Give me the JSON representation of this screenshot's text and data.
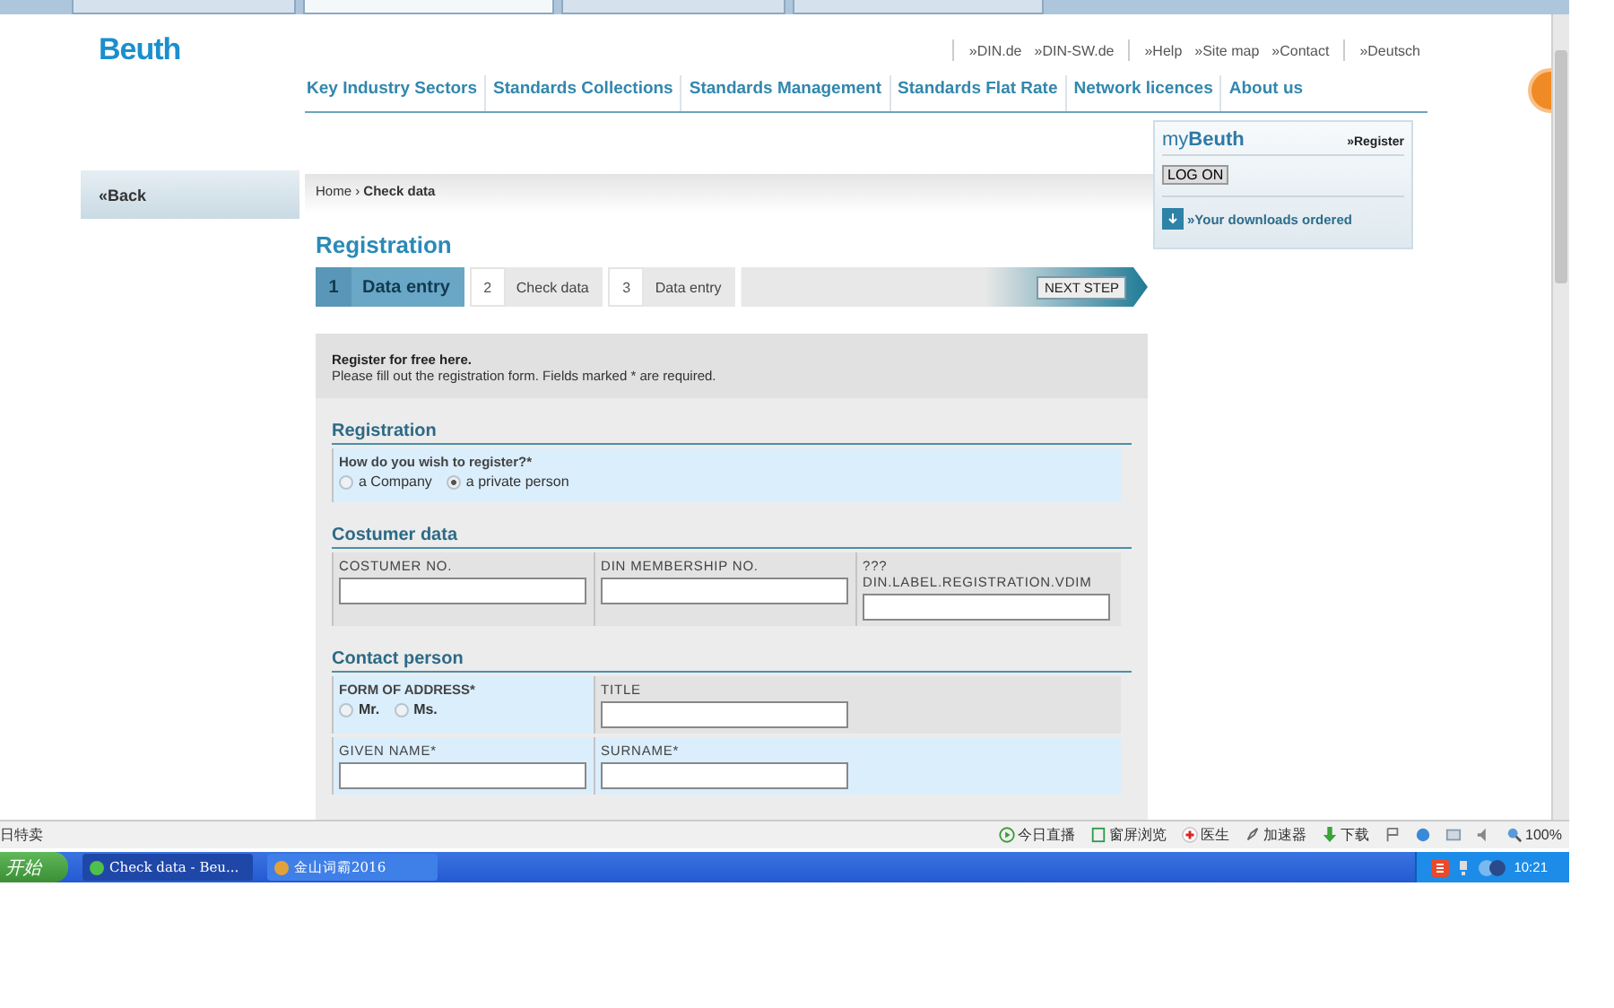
{
  "browser_tabs": [
    {
      "selected": false
    },
    {
      "selected": true
    },
    {
      "selected": false
    },
    {
      "selected": false
    }
  ],
  "site": {
    "logo": "Beuth",
    "top_links": [
      [
        "»DIN.de",
        "»DIN-SW.de"
      ],
      [
        "»Help",
        "»Site map",
        "»Contact"
      ],
      [
        "»Deutsch"
      ]
    ],
    "nav": [
      "Key Industry Sectors",
      "Standards Collections",
      "Standards Management",
      "Standards Flat Rate",
      "Network licences",
      "About us"
    ]
  },
  "back": "«Back",
  "breadcrumb": "Home › **Check data**",
  "mybeuth": {
    "prefix": "my",
    "title": "Beuth",
    "register": "»Register",
    "logon": "LOG ON",
    "downloads": "»Your downloads ordered"
  },
  "heading": "Registration",
  "steps": [
    {
      "number": "1",
      "label": "Data entry",
      "selected": true
    },
    {
      "number": "2",
      "label": "Check data",
      "selected": false
    },
    {
      "number": "3",
      "label": "Data entry",
      "selected": false
    }
  ],
  "next_step": "NEXT STEP",
  "intro": {
    "title": "Register for free here.",
    "text": "Please fill out the registration form. Fields marked * are required."
  },
  "sections": [
    {
      "title": "Registration",
      "rows": [
        {
          "cells": [
            {
              "kind": "radio",
              "highlighted": true,
              "label": "How do you wish to register?*",
              "options": [
                {
                  "label": "a Company",
                  "selected": false
                },
                {
                  "label": "a private person",
                  "selected": true
                }
              ]
            }
          ]
        }
      ]
    },
    {
      "title": "Costumer data",
      "rows": [
        {
          "cells": [
            {
              "kind": "text",
              "highlighted": false,
              "label": "COSTUMER NO."
            },
            {
              "kind": "text",
              "highlighted": false,
              "label": "DIN MEMBERSHIP NO."
            },
            {
              "kind": "text",
              "highlighted": false,
              "label": "??? DIN.LABEL.REGISTRATION.VDIM"
            }
          ]
        }
      ]
    },
    {
      "title": "Contact person",
      "rows": [
        {
          "cells": [
            {
              "kind": "radio",
              "highlighted": true,
              "label": "FORM OF ADDRESS*",
              "options": [
                {
                  "label": "Mr.",
                  "selected": false
                },
                {
                  "label": "Ms.",
                  "selected": false
                }
              ]
            },
            {
              "kind": "text",
              "highlighted": false,
              "label": "TITLE"
            }
          ]
        },
        {
          "cells": [
            {
              "kind": "text",
              "highlighted": true,
              "label": "GIVEN NAME*"
            },
            {
              "kind": "text",
              "highlighted": true,
              "label": "SURNAME*"
            }
          ]
        }
      ]
    }
  ],
  "status_bar": {
    "left": "日特卖",
    "items": [
      {
        "kind": "play",
        "label": "今日直播"
      },
      {
        "kind": "screen",
        "label": "窗屏浏览"
      },
      {
        "kind": "cross",
        "label": "医生"
      },
      {
        "kind": "rocket",
        "label": "加速器"
      },
      {
        "kind": "download",
        "label": "下载"
      }
    ],
    "zoom": "100%"
  },
  "taskbar": {
    "start": "开始",
    "tasks": [
      {
        "label": "Check data - Beu...",
        "selected": true
      },
      {
        "label": "金山词霸2016",
        "selected": false
      }
    ],
    "clock": "10:21"
  }
}
